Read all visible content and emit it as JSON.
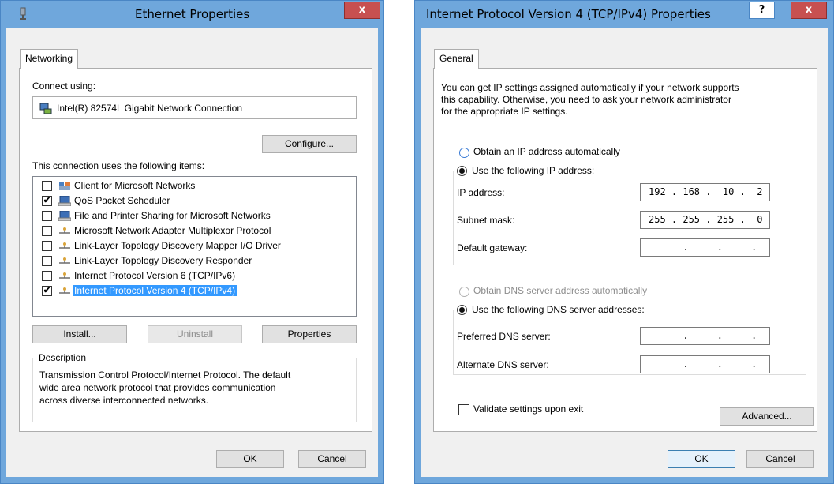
{
  "ethernet": {
    "title": "Ethernet Properties",
    "close": "x",
    "tab": "Networking",
    "connect_using_label": "Connect using:",
    "adapter_name": "Intel(R) 82574L Gigabit Network Connection",
    "configure_button": "Configure...",
    "items_label": "This connection uses the following items:",
    "items": [
      {
        "label": "Client for Microsoft Networks",
        "checked": "",
        "icon": "network-client-icon"
      },
      {
        "label": "QoS Packet Scheduler",
        "checked": "✔",
        "icon": "service-icon"
      },
      {
        "label": "File and Printer Sharing for Microsoft Networks",
        "checked": "",
        "icon": "service-icon"
      },
      {
        "label": "Microsoft Network Adapter Multiplexor Protocol",
        "checked": "",
        "icon": "protocol-icon"
      },
      {
        "label": "Link-Layer Topology Discovery Mapper I/O Driver",
        "checked": "",
        "icon": "protocol-icon"
      },
      {
        "label": "Link-Layer Topology Discovery Responder",
        "checked": "",
        "icon": "protocol-icon"
      },
      {
        "label": "Internet Protocol Version 6 (TCP/IPv6)",
        "checked": "",
        "icon": "protocol-icon"
      },
      {
        "label": "Internet Protocol Version 4 (TCP/IPv4)",
        "checked": "✔",
        "icon": "protocol-icon",
        "selected": true
      }
    ],
    "install_button": "Install...",
    "uninstall_button": "Uninstall",
    "properties_button": "Properties",
    "description_title": "Description",
    "description_text_1": "Transmission Control Protocol/Internet Protocol. The default",
    "description_text_2": "wide area network protocol that provides communication",
    "description_text_3": "across diverse interconnected networks.",
    "ok_button": "OK",
    "cancel_button": "Cancel"
  },
  "ipv4": {
    "title": "Internet Protocol Version 4 (TCP/IPv4) Properties",
    "help": "?",
    "close": "x",
    "tab": "General",
    "intro_1": "You can get IP settings assigned automatically if your network supports",
    "intro_2": "this capability. Otherwise, you need to ask your network administrator",
    "intro_3": "for the appropriate IP settings.",
    "obtain_ip_auto": "Obtain an IP address automatically",
    "use_following_ip": "Use the following IP address:",
    "ip_address_label": "IP address:",
    "ip_address_value": "192 . 168 .  10 .  2",
    "subnet_mask_label": "Subnet mask:",
    "subnet_mask_value": "255 . 255 . 255 .  0",
    "default_gateway_label": "Default gateway:",
    "default_gateway_value": "      .     .     .",
    "obtain_dns_auto": "Obtain DNS server address automatically",
    "use_following_dns": "Use the following DNS server addresses:",
    "preferred_dns_label": "Preferred DNS server:",
    "preferred_dns_value": "      .     .     .",
    "alternate_dns_label": "Alternate DNS server:",
    "alternate_dns_value": "      .     .     .",
    "validate_label": "Validate settings upon exit",
    "advanced_button": "Advanced...",
    "ok_button": "OK",
    "cancel_button": "Cancel"
  }
}
